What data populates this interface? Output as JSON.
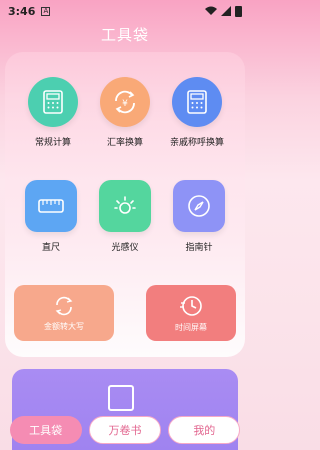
{
  "status": {
    "time": "3:46",
    "notif_badge": "A"
  },
  "header": {
    "title": "工具袋"
  },
  "tools": [
    {
      "label": "常规计算",
      "icon": "calculator-icon",
      "color": "#4ccfb0"
    },
    {
      "label": "汇率换算",
      "icon": "currency-exchange-icon",
      "color": "#f9a977"
    },
    {
      "label": "亲戚称呼换算",
      "icon": "calculator-icon",
      "color": "#5e8cf2"
    },
    {
      "label": "直尺",
      "icon": "ruler-icon",
      "color": "#5da6f3"
    },
    {
      "label": "光感仪",
      "icon": "light-sensor-icon",
      "color": "#54d69e"
    },
    {
      "label": "指南针",
      "icon": "compass-icon",
      "color": "#8e93f6"
    }
  ],
  "actions": [
    {
      "label": "金额转大写",
      "icon": "yuan-convert-icon",
      "color": "#f7a88c"
    },
    {
      "label": "时间屏幕",
      "icon": "clock-icon",
      "color": "#f27e7e"
    }
  ],
  "nav": {
    "tab1": "工具袋",
    "tab2": "万卷书",
    "tab3": "我的"
  }
}
